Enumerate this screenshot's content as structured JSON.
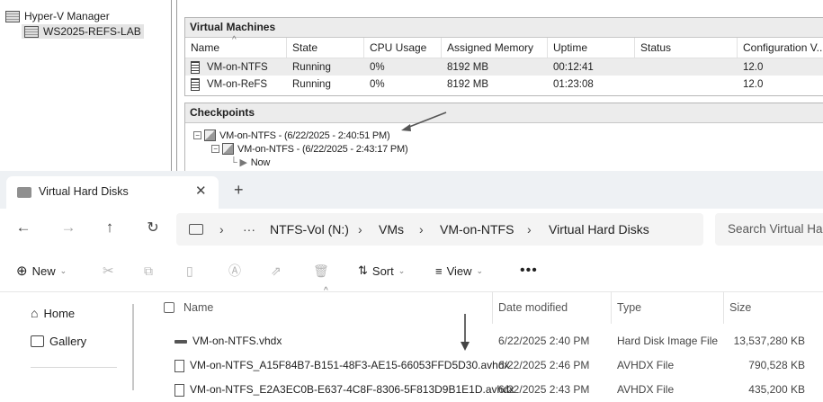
{
  "hyperv": {
    "tree": {
      "root": "Hyper-V Manager",
      "server": "WS2025-REFS-LAB"
    },
    "vm_panel": {
      "title": "Virtual Machines",
      "columns": [
        "Name",
        "State",
        "CPU Usage",
        "Assigned Memory",
        "Uptime",
        "Status",
        "Configuration V..."
      ],
      "rows": [
        {
          "name": "VM-on-NTFS",
          "state": "Running",
          "cpu": "0%",
          "memory": "8192 MB",
          "uptime": "00:12:41",
          "status": "",
          "config": "12.0"
        },
        {
          "name": "VM-on-ReFS",
          "state": "Running",
          "cpu": "0%",
          "memory": "8192 MB",
          "uptime": "01:23:08",
          "status": "",
          "config": "12.0"
        }
      ]
    },
    "checkpoints": {
      "title": "Checkpoints",
      "items": [
        "VM-on-NTFS - (6/22/2025 - 2:40:51 PM)",
        "VM-on-NTFS - (6/22/2025 - 2:43:17 PM)",
        "Now"
      ]
    }
  },
  "explorer": {
    "tab_title": "Virtual Hard Disks",
    "breadcrumb": [
      "NTFS-Vol (N:)",
      "VMs",
      "VM-on-NTFS",
      "Virtual Hard Disks"
    ],
    "search_placeholder": "Search Virtual Ha",
    "commands": {
      "new": "New",
      "sort": "Sort",
      "view": "View"
    },
    "nav": {
      "home": "Home",
      "gallery": "Gallery"
    },
    "columns": [
      "Name",
      "Date modified",
      "Type",
      "Size"
    ],
    "files": [
      {
        "name": "VM-on-NTFS.vhdx",
        "date": "6/22/2025 2:40 PM",
        "type": "Hard Disk Image File",
        "size": "13,537,280 KB",
        "icon": "vhd-icon"
      },
      {
        "name": "VM-on-NTFS_A15F84B7-B151-48F3-AE15-66053FFD5D30.avhdx",
        "date": "6/22/2025 2:46 PM",
        "type": "AVHDX File",
        "size": "790,528 KB",
        "icon": "file-icon"
      },
      {
        "name": "VM-on-NTFS_E2A3EC0B-E637-4C8F-8306-5F813D9B1E1D.avhdx",
        "date": "6/22/2025 2:43 PM",
        "type": "AVHDX File",
        "size": "435,200 KB",
        "icon": "file-icon"
      }
    ]
  }
}
